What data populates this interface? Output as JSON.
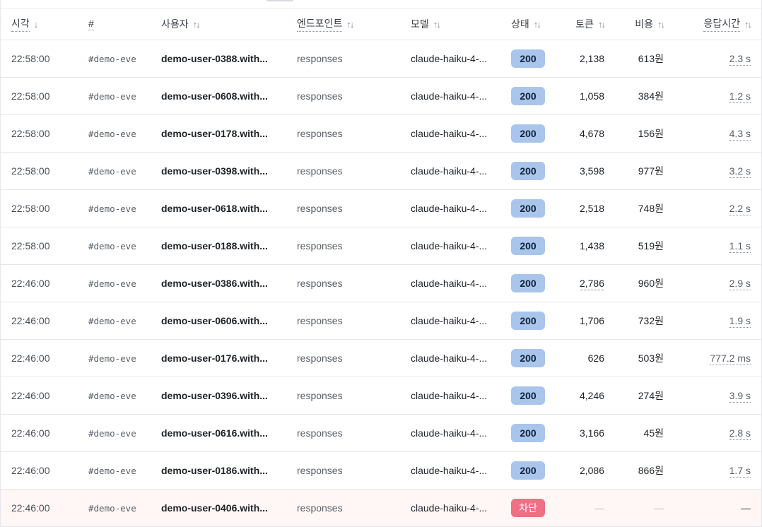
{
  "table": {
    "columns": [
      {
        "key": "time",
        "label": "시각",
        "sort_icon": "arrow-down-icon",
        "glyph": "↓"
      },
      {
        "key": "id",
        "label": "#",
        "sort_icon": "",
        "glyph": ""
      },
      {
        "key": "user",
        "label": "사용자",
        "sort_icon": "sort-icon",
        "glyph": "↑↓"
      },
      {
        "key": "endpoint",
        "label": "엔드포인트",
        "sort_icon": "sort-icon",
        "glyph": "↑↓"
      },
      {
        "key": "model",
        "label": "모델",
        "sort_icon": "sort-icon",
        "glyph": "↑↓"
      },
      {
        "key": "status",
        "label": "상태",
        "sort_icon": "sort-icon",
        "glyph": "↑↓"
      },
      {
        "key": "tokens",
        "label": "토큰",
        "sort_icon": "sort-icon",
        "glyph": "↑↓"
      },
      {
        "key": "cost",
        "label": "비용",
        "sort_icon": "sort-icon",
        "glyph": "↑↓"
      },
      {
        "key": "latency",
        "label": "응답시간",
        "sort_icon": "sort-icon",
        "glyph": "↑↓"
      }
    ],
    "rows": [
      {
        "time": "22:58:00",
        "id": "#demo-eve",
        "user": "demo-user-0388.with...",
        "endpoint": "responses",
        "model": "claude-haiku-4-...",
        "status": "200",
        "tokens": "2,138",
        "cost": "613원",
        "latency": "2.3 s"
      },
      {
        "time": "22:58:00",
        "id": "#demo-eve",
        "user": "demo-user-0608.with...",
        "endpoint": "responses",
        "model": "claude-haiku-4-...",
        "status": "200",
        "tokens": "1,058",
        "cost": "384원",
        "latency": "1.2 s"
      },
      {
        "time": "22:58:00",
        "id": "#demo-eve",
        "user": "demo-user-0178.with...",
        "endpoint": "responses",
        "model": "claude-haiku-4-...",
        "status": "200",
        "tokens": "4,678",
        "cost": "156원",
        "latency": "4.3 s"
      },
      {
        "time": "22:58:00",
        "id": "#demo-eve",
        "user": "demo-user-0398.with...",
        "endpoint": "responses",
        "model": "claude-haiku-4-...",
        "status": "200",
        "tokens": "3,598",
        "cost": "977원",
        "latency": "3.2 s"
      },
      {
        "time": "22:58:00",
        "id": "#demo-eve",
        "user": "demo-user-0618.with...",
        "endpoint": "responses",
        "model": "claude-haiku-4-...",
        "status": "200",
        "tokens": "2,518",
        "cost": "748원",
        "latency": "2.2 s"
      },
      {
        "time": "22:58:00",
        "id": "#demo-eve",
        "user": "demo-user-0188.with...",
        "endpoint": "responses",
        "model": "claude-haiku-4-...",
        "status": "200",
        "tokens": "1,438",
        "cost": "519원",
        "latency": "1.1 s"
      },
      {
        "time": "22:46:00",
        "id": "#demo-eve",
        "user": "demo-user-0386.with...",
        "endpoint": "responses",
        "model": "claude-haiku-4-...",
        "status": "200",
        "tokens": "2,786",
        "cost": "960원",
        "latency": "2.9 s",
        "tokens_dotted": true
      },
      {
        "time": "22:46:00",
        "id": "#demo-eve",
        "user": "demo-user-0606.with...",
        "endpoint": "responses",
        "model": "claude-haiku-4-...",
        "status": "200",
        "tokens": "1,706",
        "cost": "732원",
        "latency": "1.9 s"
      },
      {
        "time": "22:46:00",
        "id": "#demo-eve",
        "user": "demo-user-0176.with...",
        "endpoint": "responses",
        "model": "claude-haiku-4-...",
        "status": "200",
        "tokens": "626",
        "cost": "503원",
        "latency": "777.2 ms"
      },
      {
        "time": "22:46:00",
        "id": "#demo-eve",
        "user": "demo-user-0396.with...",
        "endpoint": "responses",
        "model": "claude-haiku-4-...",
        "status": "200",
        "tokens": "4,246",
        "cost": "274원",
        "latency": "3.9 s"
      },
      {
        "time": "22:46:00",
        "id": "#demo-eve",
        "user": "demo-user-0616.with...",
        "endpoint": "responses",
        "model": "claude-haiku-4-...",
        "status": "200",
        "tokens": "3,166",
        "cost": "45원",
        "latency": "2.8 s"
      },
      {
        "time": "22:46:00",
        "id": "#demo-eve",
        "user": "demo-user-0186.with...",
        "endpoint": "responses",
        "model": "claude-haiku-4-...",
        "status": "200",
        "tokens": "2,086",
        "cost": "866원",
        "latency": "1.7 s"
      },
      {
        "time": "22:46:00",
        "id": "#demo-eve",
        "user": "demo-user-0406.with...",
        "endpoint": "responses",
        "model": "claude-haiku-4-...",
        "status": "차단",
        "status_kind": "blocked",
        "tokens": "—",
        "cost": "—",
        "latency": "—"
      }
    ]
  },
  "colors": {
    "status_ok_bg": "#a9c5ec",
    "status_blocked_bg": "#ef6f84",
    "blocked_row_bg": "#fff6f6"
  }
}
